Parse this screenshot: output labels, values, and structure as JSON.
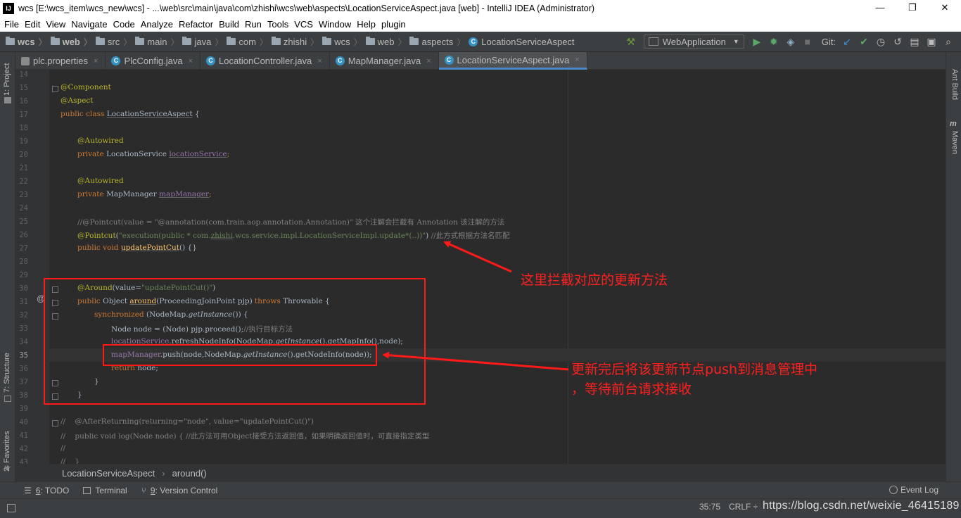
{
  "window": {
    "title": "wcs [E:\\wcs_item\\wcs_new\\wcs] - ...\\web\\src\\main\\java\\com\\zhishi\\wcs\\web\\aspects\\LocationServiceAspect.java [web] - IntelliJ IDEA (Administrator)",
    "app_icon": "IJ",
    "minimize": "—",
    "restore": "❐",
    "close": "✕"
  },
  "menu": [
    {
      "label": "File"
    },
    {
      "label": "Edit"
    },
    {
      "label": "View"
    },
    {
      "label": "Navigate"
    },
    {
      "label": "Code"
    },
    {
      "label": "Analyze"
    },
    {
      "label": "Refactor"
    },
    {
      "label": "Build"
    },
    {
      "label": "Run"
    },
    {
      "label": "Tools"
    },
    {
      "label": "VCS"
    },
    {
      "label": "Window"
    },
    {
      "label": "Help"
    },
    {
      "label": "plugin"
    }
  ],
  "nav": {
    "crumbs": [
      "wcs",
      "web",
      "src",
      "main",
      "java",
      "com",
      "zhishi",
      "wcs",
      "web",
      "aspects",
      "LocationServiceAspect"
    ],
    "run_config": "WebApplication",
    "git_label": "Git:",
    "icons": [
      "hammer-icon",
      "run-icon",
      "debug-icon",
      "coverage-icon",
      "stop-icon"
    ]
  },
  "tabs": [
    {
      "label": "plc.properties",
      "kind": "properties"
    },
    {
      "label": "PlcConfig.java",
      "kind": "class"
    },
    {
      "label": "LocationController.java",
      "kind": "class"
    },
    {
      "label": "MapManager.java",
      "kind": "class"
    },
    {
      "label": "LocationServiceAspect.java",
      "kind": "class",
      "active": true
    }
  ],
  "tab_close": "×",
  "left_tools": {
    "project": "1: Project",
    "structure": "7: Structure",
    "favorites": "2: Favorites"
  },
  "right_tools": {
    "ant": "Ant Build",
    "maven": "Maven"
  },
  "line_numbers": [
    "14",
    "15",
    "16",
    "17",
    "18",
    "19",
    "20",
    "21",
    "22",
    "23",
    "24",
    "25",
    "26",
    "27",
    "28",
    "29",
    "30",
    "31",
    "32",
    "33",
    "34",
    "35",
    "36",
    "37",
    "38",
    "39",
    "40",
    "41",
    "42",
    "43"
  ],
  "code": {
    "l15": "@Component",
    "l16": "@Aspect",
    "l17_kw": "public class ",
    "l17_name": "LocationServiceAspect",
    "l17_end": " {",
    "l19": "@Autowired",
    "l20_kw": "private ",
    "l20_type": "LocationService ",
    "l20_field": "locationService",
    "l20_end": ";",
    "l22": "@Autowired",
    "l23_kw": "private ",
    "l23_type": "MapManager ",
    "l23_field": "mapManager",
    "l23_end": ";",
    "l25": "//@Pointcut(value = \"@annotation(com.train.aop.annotation.Annotation)\" 这个注解会拦截有 Annotation 该注解的方法",
    "l26_ann": "@Pointcut",
    "l26_a": "(",
    "l26_str1": "\"execution(public * com.",
    "l26_str2": "zhishi",
    "l26_str3": ".wcs.service.impl.LocationServiceImpl.update*(..))\"",
    "l26_b": ") ",
    "l26_cm": "//此方式根据方法名匹配",
    "l27_kw": "public void ",
    "l27_name": "updatePointCut",
    "l27_end": "() {}",
    "l30_ann": "@Around",
    "l30_a": "(value=",
    "l30_str": "\"updatePointCut()\"",
    "l30_b": ")",
    "l31_kw": "public ",
    "l31_type": "Object ",
    "l31_name": "around",
    "l31_params": "(ProceedingJoinPoint pjp) ",
    "l31_kw2": "throws ",
    "l31_exc": "Throwable {",
    "l32_kw": "synchronized ",
    "l32_a": "(NodeMap.",
    "l32_it": "getInstance",
    "l32_b": "()) {",
    "l33_code": "Node node = (Node) pjp.proceed();",
    "l33_cm": "//执行目标方法",
    "l34_field": "locationService",
    "l34_rest": ".refreshNodeInfo(NodeMap.",
    "l34_it": "getInstance",
    "l34_end": "().getMapInfo(),node);",
    "l35_field": "mapManager",
    "l35_a": ".push(node,NodeMap.",
    "l35_it": "getInstance",
    "l35_b": "().getNodeInfo(node));",
    "l36_kw": "return ",
    "l36_rest": "node;",
    "l37": "}",
    "l38": "}",
    "l40": "//    @AfterReturning(returning=\"node\", value=\"updatePointCut()\")",
    "l41": "//    public void log(Node node) { //此方法可用Object接受方法返回值，如果明确返回值时，可直接指定类型",
    "l42": "//",
    "l43": "//    }"
  },
  "gutter_at": "@",
  "annotations": {
    "note1": "这里拦截对应的更新方法",
    "note2_line1": "更新完后将该更新节点push到消息管理中",
    "note2_line2": "，等待前台请求接收",
    "color": "#ff1a1a"
  },
  "editor_breadcrumb": {
    "class": "LocationServiceAspect",
    "method": "around()"
  },
  "bottom_tools": {
    "todo_num": "6",
    "todo_label": ": TODO",
    "terminal": "Terminal",
    "vc_num": "9",
    "vc_label": ": Version Control",
    "event_log": "Event Log"
  },
  "status": {
    "position": "35:75",
    "line_sep": "CRLF ÷",
    "watermark": "https://blog.csdn.net/weixie_46415189"
  }
}
